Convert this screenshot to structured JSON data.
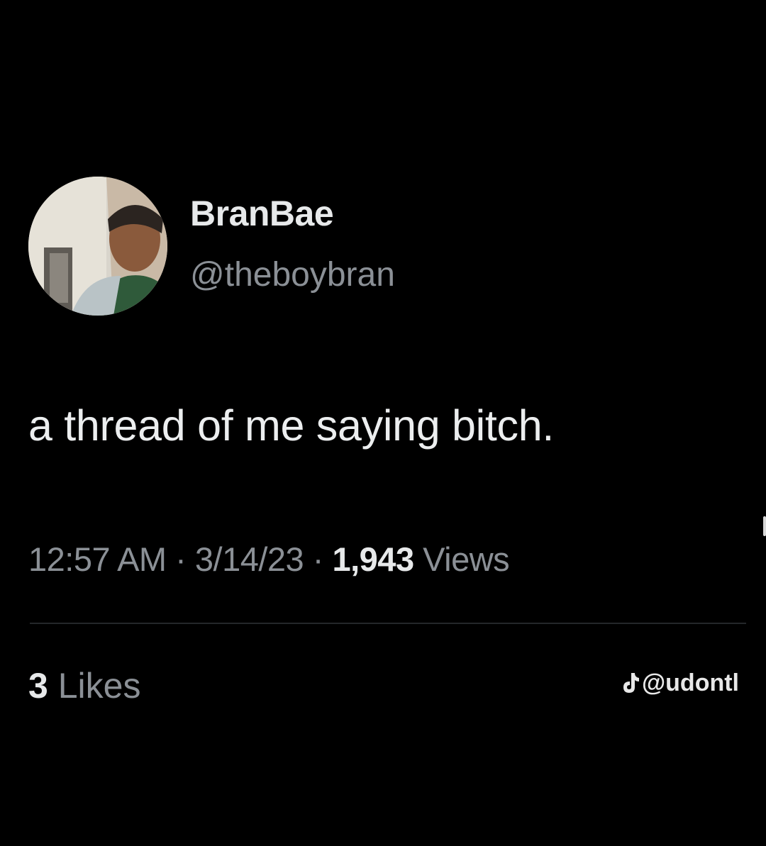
{
  "tweet": {
    "display_name": "BranBae",
    "handle": "@theboybran",
    "text": "a thread of me saying bitch.",
    "time": "12:57 AM",
    "separator": "·",
    "date": "3/14/23",
    "views_count": "1,943",
    "views_label": "Views",
    "likes_count": "3",
    "likes_label": "Likes"
  },
  "watermark": {
    "icon": "tiktok-icon",
    "handle": "@udontl"
  },
  "colors": {
    "background": "#000000",
    "primary_text": "#e7e9ea",
    "secondary_text": "#8b9096",
    "divider": "#24272a"
  }
}
